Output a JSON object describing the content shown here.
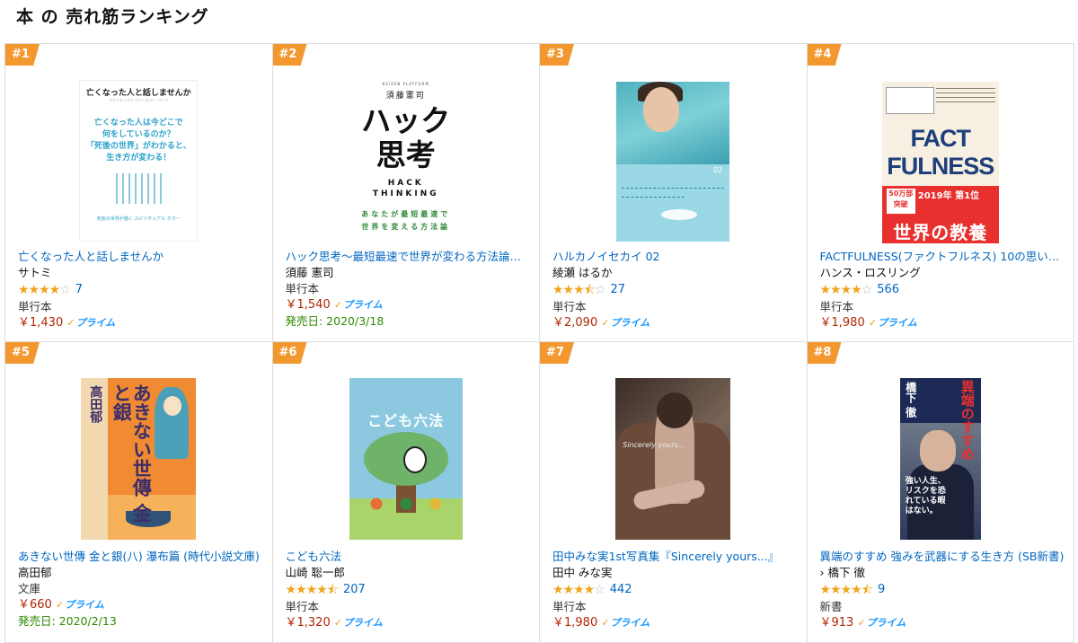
{
  "page_title": "本 の 売れ筋ランキング",
  "products": [
    {
      "rank": "#1",
      "title": "亡くなった人と話しませんか",
      "author": "サトミ",
      "stars": 4,
      "rating_count": "7",
      "format": "単行本",
      "price": "￥1,430",
      "prime": "プライム",
      "release": "",
      "cover": {
        "heading": "亡くなった人と話しませんか",
        "sub": "スピリチュアル カウンセラー サトミ",
        "lines": [
          "亡くなった人は今どこで",
          "何をしているのか？",
          "「死後の世界」がわかると、",
          "生き方が変わる！"
        ],
        "foot": "死後の世界が描く スピリチュアル カラー"
      }
    },
    {
      "rank": "#2",
      "title": "ハック思考〜最短最速で世界が変わる方法論〜…",
      "author": "須藤 憲司",
      "stars": 0,
      "rating_count": "",
      "format": "単行本",
      "price": "￥1,540",
      "prime": "プライム",
      "release": "発売日: 2020/3/18",
      "cover": {
        "series": "KAIZEN PLATFORM",
        "author": "須藤憲司",
        "title": [
          "ハック",
          "思考"
        ],
        "english": [
          "HACK",
          "THINKING"
        ],
        "green": [
          "あなたが最短最速で",
          "世界を変える方法論"
        ]
      }
    },
    {
      "rank": "#3",
      "title": "ハルカノイセカイ 02",
      "author": "綾瀬 はるか",
      "stars": 3.5,
      "rating_count": "27",
      "format": "単行本",
      "price": "￥2,090",
      "prime": "プライム",
      "release": "",
      "cover": {
        "num": "02"
      }
    },
    {
      "rank": "#4",
      "title": "FACTFULNESS(ファクトフルネス) 10の思い込…",
      "author": "ハンス・ロスリング",
      "stars": 4,
      "rating_count": "566",
      "format": "単行本",
      "price": "￥1,980",
      "prime": "プライム",
      "release": "",
      "cover": {
        "title": [
          "FACT",
          "FULNESS"
        ],
        "badge": "50万部 突破",
        "top": "2019年 第1位",
        "bottom": "世界の教養"
      }
    },
    {
      "rank": "#5",
      "title": "あきない世傳 金と銀(八) 瀑布篇 (時代小説文庫)",
      "author": "高田郁",
      "stars": 0,
      "rating_count": "",
      "format": "文庫",
      "price": "￥660",
      "prime": "プライム",
      "release": "発売日: 2020/2/13",
      "cover": {
        "author": "高田郁",
        "title": "あきない世傳 金と銀"
      }
    },
    {
      "rank": "#6",
      "title": "こども六法",
      "author": "山崎 聡一郎",
      "stars": 4.5,
      "rating_count": "207",
      "format": "単行本",
      "price": "￥1,320",
      "prime": "プライム",
      "release": "",
      "cover": {
        "title": "こども六法"
      }
    },
    {
      "rank": "#7",
      "title": "田中みな実1st写真集『Sincerely yours...』",
      "author": "田中 みな実",
      "stars": 4,
      "rating_count": "442",
      "format": "単行本",
      "price": "￥1,980",
      "prime": "プライム",
      "release": "",
      "cover": {
        "sign": "Sincerely yours..."
      }
    },
    {
      "rank": "#8",
      "title": "異端のすすめ 強みを武器にする生き方 (SB新書)",
      "author": "› 橋下 徹",
      "stars": 4.5,
      "rating_count": "9",
      "format": "新書",
      "price": "￥913",
      "prime": "プライム",
      "release": "",
      "cover": {
        "red": "異端のすすめ",
        "name": "橋下 徹",
        "white": "強い人生、リスクを恐れている暇はない。"
      }
    }
  ]
}
